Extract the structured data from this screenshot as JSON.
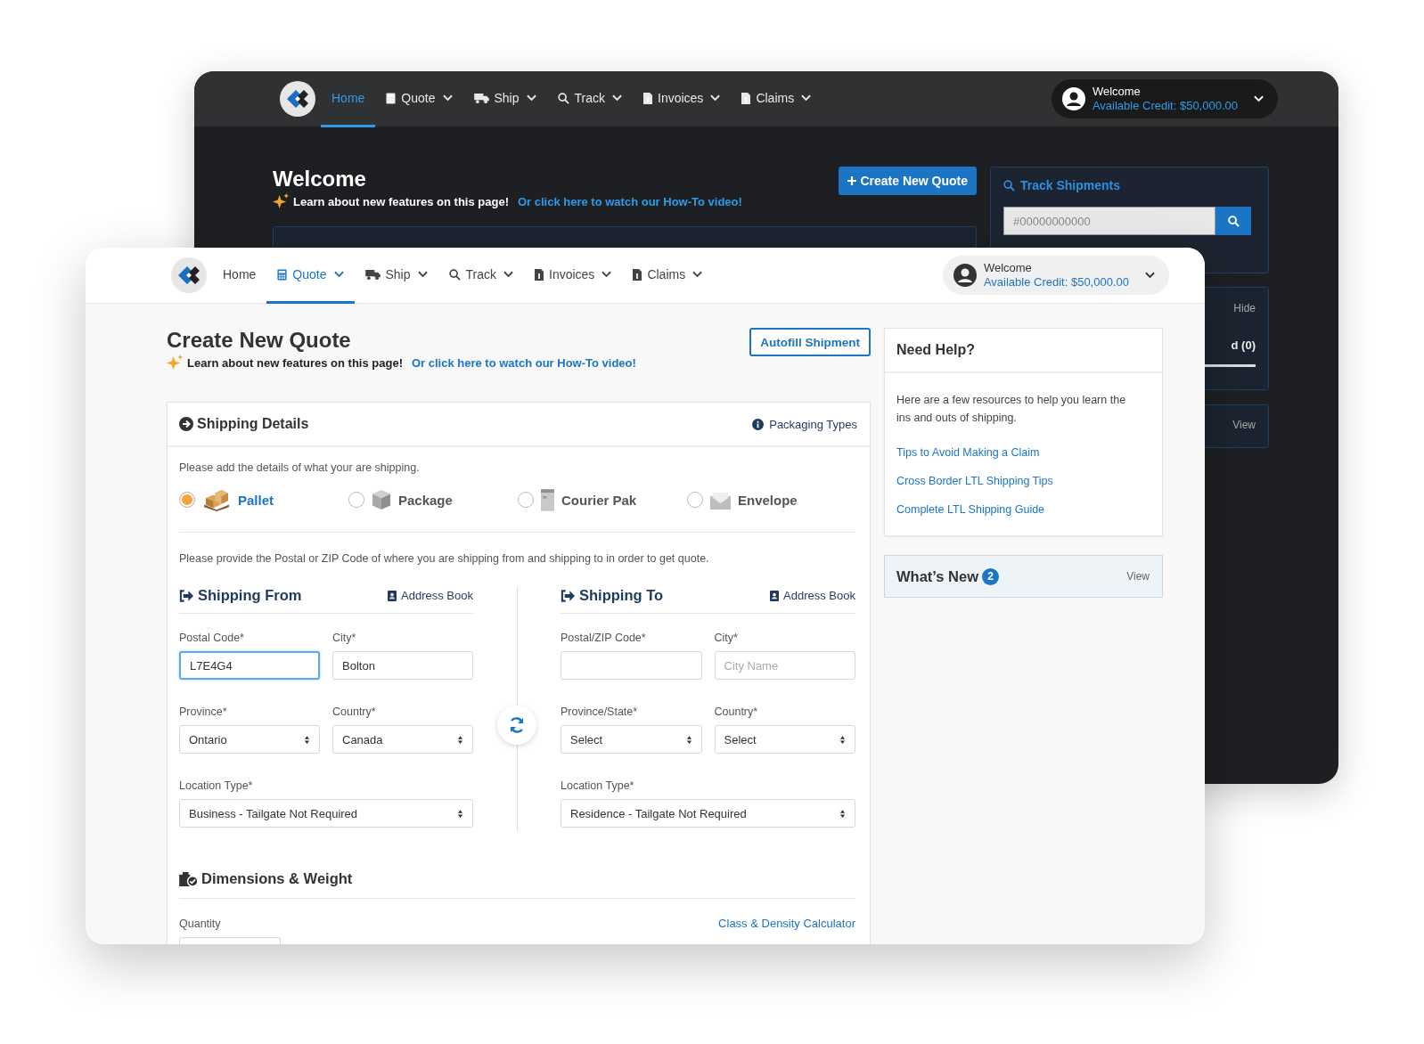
{
  "back_window": {
    "nav": {
      "items": [
        {
          "label": "Home",
          "selected": true,
          "dropdown": false
        },
        {
          "label": "Quote",
          "selected": false,
          "dropdown": true
        },
        {
          "label": "Ship",
          "selected": false,
          "dropdown": true
        },
        {
          "label": "Track",
          "selected": false,
          "dropdown": true
        },
        {
          "label": "Invoices",
          "selected": false,
          "dropdown": true
        },
        {
          "label": "Claims",
          "selected": false,
          "dropdown": true
        }
      ],
      "account": {
        "greeting": "Welcome",
        "credit": "Available Credit: $50,000.00"
      }
    },
    "title": "Welcome",
    "features_text": "Learn about new features on this page!",
    "video_link": "Or click here to watch our How-To video!",
    "create_button": "Create New Quote",
    "track": {
      "title": "Track Shipments",
      "placeholder": "#00000000000"
    },
    "reminders_panel": {
      "action": "Hide",
      "tab": "d (0)"
    },
    "view_panel": {
      "action": "View"
    }
  },
  "front_window": {
    "nav": {
      "items": [
        {
          "label": "Home",
          "selected": false,
          "dropdown": false
        },
        {
          "label": "Quote",
          "selected": true,
          "dropdown": true
        },
        {
          "label": "Ship",
          "selected": false,
          "dropdown": true
        },
        {
          "label": "Track",
          "selected": false,
          "dropdown": true
        },
        {
          "label": "Invoices",
          "selected": false,
          "dropdown": true
        },
        {
          "label": "Claims",
          "selected": false,
          "dropdown": true
        }
      ],
      "account": {
        "greeting": "Welcome",
        "credit": "Available Credit: $50,000.00"
      }
    },
    "title": "Create New Quote",
    "features_text": "Learn about new features on this page!",
    "video_link": "Or click here to watch our How-To video!",
    "autofill_button": "Autofill Shipment",
    "shipping_details": {
      "title": "Shipping Details",
      "packaging_link": "Packaging Types",
      "intro": "Please add the details of what your are shipping.",
      "types": [
        {
          "label": "Pallet",
          "selected": true
        },
        {
          "label": "Package",
          "selected": false
        },
        {
          "label": "Courier Pak",
          "selected": false
        },
        {
          "label": "Envelope",
          "selected": false
        }
      ],
      "postal_intro": "Please provide the Postal or ZIP Code of where you are shipping from and shipping to in order to get quote.",
      "sides": [
        {
          "title": "Shipping From",
          "address_book": "Address Book",
          "fields": [
            {
              "label": "Postal Code*",
              "kind": "input",
              "value": "L7E4G4",
              "focused": true
            },
            {
              "label": "City*",
              "kind": "input",
              "value": "Bolton",
              "focused": false
            },
            {
              "label": "Province*",
              "kind": "select",
              "value": "Ontario"
            },
            {
              "label": "Country*",
              "kind": "select",
              "value": "Canada"
            },
            {
              "label": "Location Type*",
              "kind": "select",
              "value": "Business - Tailgate Not Required"
            }
          ]
        },
        {
          "title": "Shipping To",
          "address_book": "Address Book",
          "fields": [
            {
              "label": "Postal/ZIP Code*",
              "kind": "input",
              "focused": false
            },
            {
              "label": "City*",
              "kind": "input",
              "placeholder": "City Name",
              "focused": false
            },
            {
              "label": "Province/State*",
              "kind": "select",
              "value": "Select"
            },
            {
              "label": "Country*",
              "kind": "select",
              "value": "Select"
            },
            {
              "label": "Location Type*",
              "kind": "select",
              "value": "Residence - Tailgate Not Required"
            }
          ]
        }
      ]
    },
    "dimensions": {
      "title": "Dimensions & Weight",
      "quantity_label": "Quantity",
      "calculator_link": "Class & Density Calculator"
    },
    "help": {
      "title": "Need Help?",
      "text": "Here are a few resources to help you learn the ins and outs of shipping.",
      "links": [
        "Tips to Avoid Making a Claim",
        "Cross Border LTL Shipping Tips",
        "Complete LTL Shipping Guide"
      ]
    },
    "whats_new": {
      "title": "What’s New",
      "count": "2",
      "action": "View"
    }
  }
}
